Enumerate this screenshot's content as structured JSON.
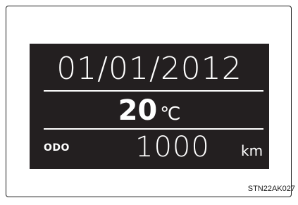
{
  "display": {
    "date": "01/01/2012",
    "temperature": {
      "value": "20",
      "unit": "℃"
    },
    "odometer": {
      "label": "ODO",
      "value": "1000",
      "unit": "km"
    }
  },
  "caption": "STN22AK027",
  "colors": {
    "display_background": "#231f20",
    "display_text": "#ffffff",
    "page_background": "#ffffff"
  }
}
